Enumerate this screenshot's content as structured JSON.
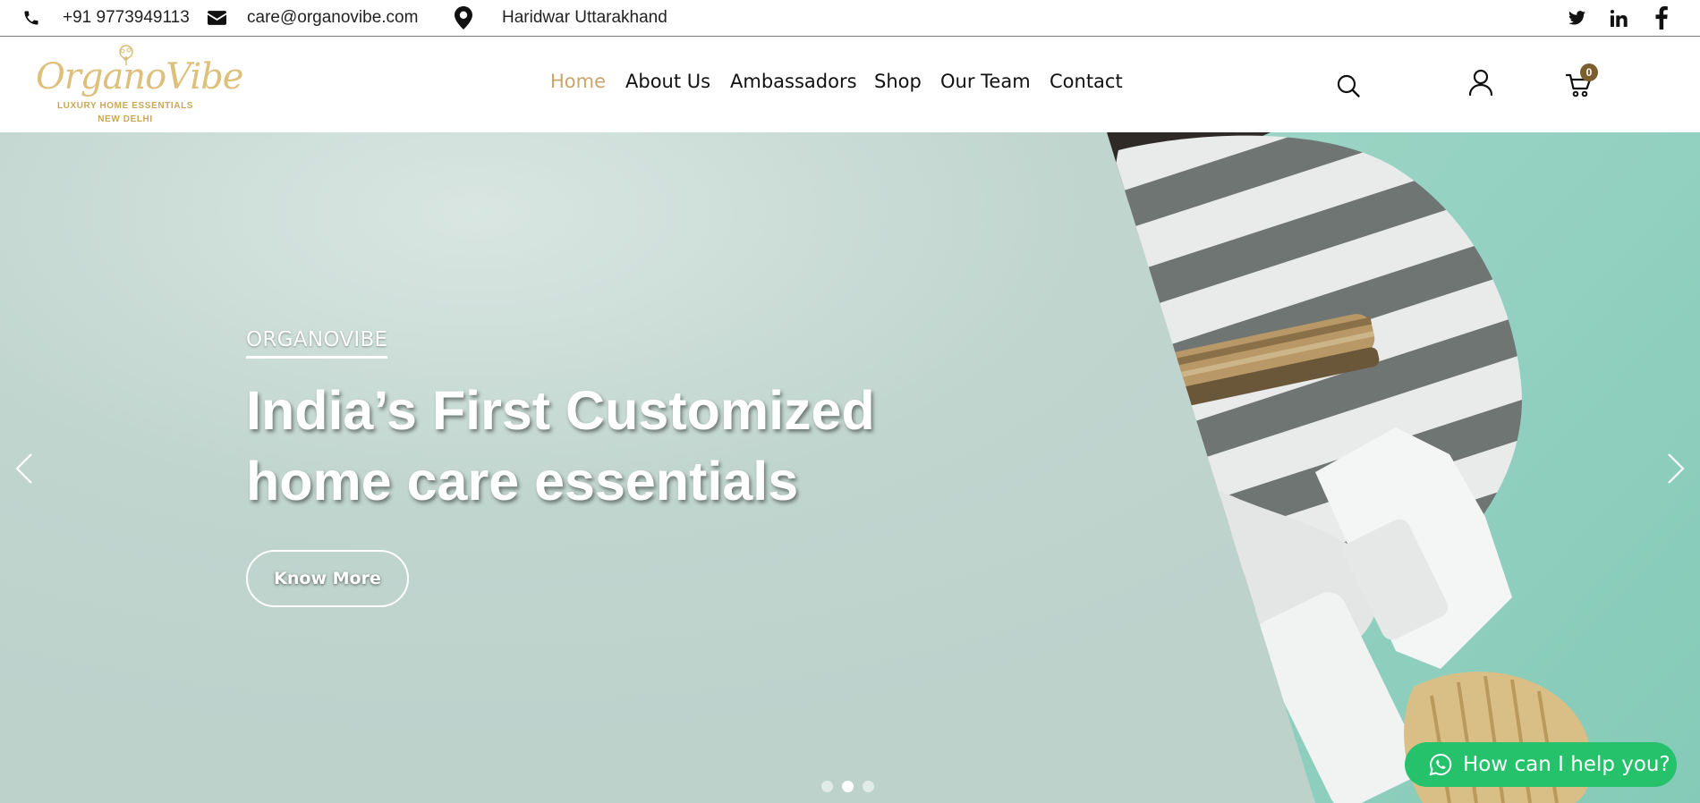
{
  "topbar": {
    "phone": "+91 9773949113",
    "email": "care@organovibe.com",
    "location": "Haridwar Uttarakhand",
    "phone_icon": "phone-icon",
    "email_icon": "envelope-icon",
    "location_icon": "map-pin-icon",
    "social": [
      "twitter-icon",
      "linkedin-icon",
      "facebook-icon"
    ]
  },
  "header": {
    "logo": {
      "script": "OrganoVibe",
      "tagline": "LUXURY HOME ESSENTIALS",
      "city": "NEW DELHI",
      "color": "#dcc07c"
    },
    "nav": [
      {
        "label": "Home",
        "active": true
      },
      {
        "label": "About Us",
        "active": false
      },
      {
        "label": "Ambassadors",
        "active": false
      },
      {
        "label": "Shop",
        "active": false
      },
      {
        "label": "Our Team",
        "active": false
      },
      {
        "label": "Contact",
        "active": false
      }
    ],
    "active_color": "#c9a46b",
    "icons": [
      "search-icon",
      "user-icon",
      "cart-icon"
    ],
    "cart_count": "0"
  },
  "hero": {
    "eyebrow": "ORGANOVIBE",
    "title_line1": "India’s First Customized",
    "title_line2": "home care essentials",
    "button": "Know More",
    "background": "#bcd2cb",
    "slides": 3,
    "active_slide": 2
  },
  "whatsapp": {
    "label": "How can I help you?",
    "color": "#25c16b",
    "icon": "whatsapp-icon"
  }
}
